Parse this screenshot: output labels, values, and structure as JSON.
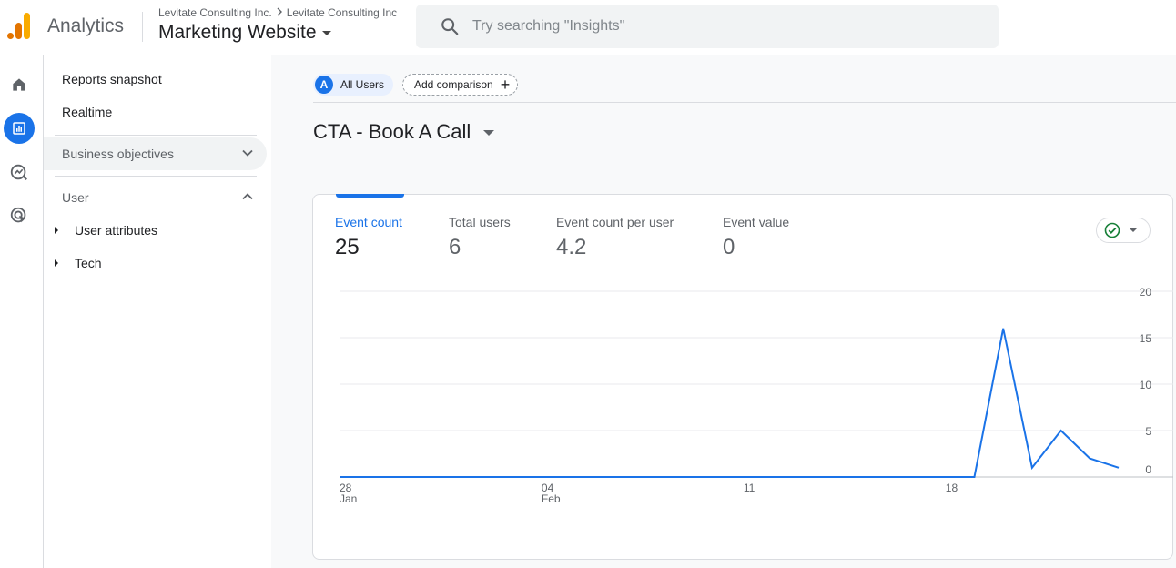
{
  "header": {
    "app_name": "Analytics",
    "breadcrumb_account": "Levitate Consulting Inc.",
    "breadcrumb_property": "Levitate Consulting Inc",
    "property_name": "Marketing Website",
    "search_placeholder": "Try searching \"Insights\""
  },
  "rail": {
    "items": [
      "home-icon",
      "reports-icon",
      "explore-icon",
      "advertising-icon"
    ],
    "active": "reports-icon"
  },
  "nav": {
    "reports_snapshot": "Reports snapshot",
    "realtime": "Realtime",
    "business_objectives": "Business objectives",
    "user_section": "User",
    "user_attributes": "User attributes",
    "tech": "Tech"
  },
  "main": {
    "users_chip_avatar": "A",
    "users_chip": "All Users",
    "add_comparison": "Add comparison",
    "card_title": "CTA - Book A Call"
  },
  "metrics": [
    {
      "label": "Event count",
      "value": "25"
    },
    {
      "label": "Total users",
      "value": "6"
    },
    {
      "label": "Event count per user",
      "value": "4.2"
    },
    {
      "label": "Event value",
      "value": "0"
    }
  ],
  "colors": {
    "accent": "#1a73e8",
    "check": "#188038",
    "logo_dark": "#e37400",
    "logo_light": "#f9ab00"
  },
  "chart_data": {
    "type": "line",
    "series": [
      {
        "values": [
          0,
          0,
          0,
          0,
          0,
          0,
          0,
          0,
          0,
          0,
          0,
          0,
          0,
          0,
          0,
          0,
          0,
          0,
          0,
          0,
          0,
          0,
          0,
          16,
          1,
          5,
          2,
          1
        ]
      }
    ],
    "x_ticks": [
      {
        "index": 0,
        "day": "28",
        "month": "Jan"
      },
      {
        "index": 7,
        "day": "04",
        "month": "Feb"
      },
      {
        "index": 14,
        "day": "11",
        "month": ""
      },
      {
        "index": 21,
        "day": "18",
        "month": ""
      }
    ],
    "y_ticks": [
      0,
      5,
      10,
      15,
      20
    ],
    "ylim": [
      0,
      20
    ],
    "grid": true
  }
}
